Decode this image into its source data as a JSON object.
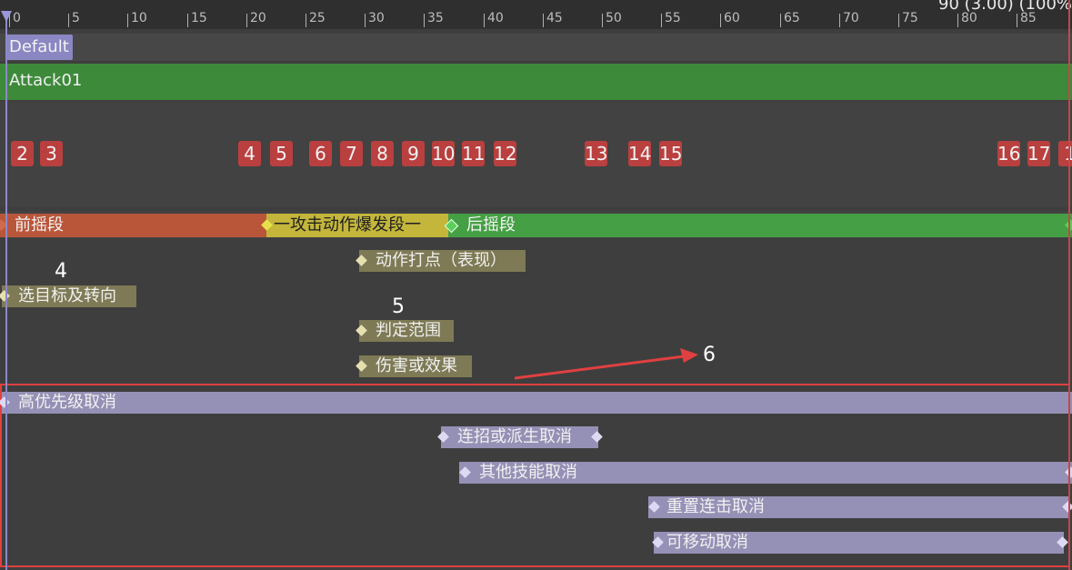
{
  "ruler": {
    "ticks": [
      "0",
      "5",
      "10",
      "15",
      "20",
      "25",
      "30",
      "35",
      "40",
      "45",
      "50",
      "55",
      "60",
      "65",
      "70",
      "75",
      "80",
      "85"
    ],
    "readout": "90 (3.00) (100%"
  },
  "tracks": {
    "slot": "Default",
    "montage": "Attack01"
  },
  "markers": [
    "2",
    "3",
    "4",
    "5",
    "6",
    "7",
    "8",
    "9",
    "10",
    "11",
    "12",
    "13",
    "14",
    "15",
    "16",
    "17",
    "1"
  ],
  "phases": {
    "pre": "前摇段",
    "burst": "一攻击动作爆发段一",
    "post": "后摇段"
  },
  "notifies": {
    "hit_point": "动作打点（表现）",
    "target_turn": "选目标及转向",
    "judge_range": "判定范围",
    "damage_effect": "伤害或效果",
    "cancel_high": "高优先级取消",
    "cancel_combo": "连招或派生取消",
    "cancel_skill": "其他技能取消",
    "cancel_reset": "重置连击取消",
    "cancel_move": "可移动取消"
  },
  "annotations": [
    "4",
    "5",
    "6"
  ],
  "colors": {
    "pre_phase": "#b9563a",
    "burst_phase": "#c3b63b",
    "post_phase": "#45a045",
    "montage": "#3d8a3a",
    "marker": "#b9403f",
    "cancel_bar": "#9590b5",
    "highlight": "#e04040"
  }
}
